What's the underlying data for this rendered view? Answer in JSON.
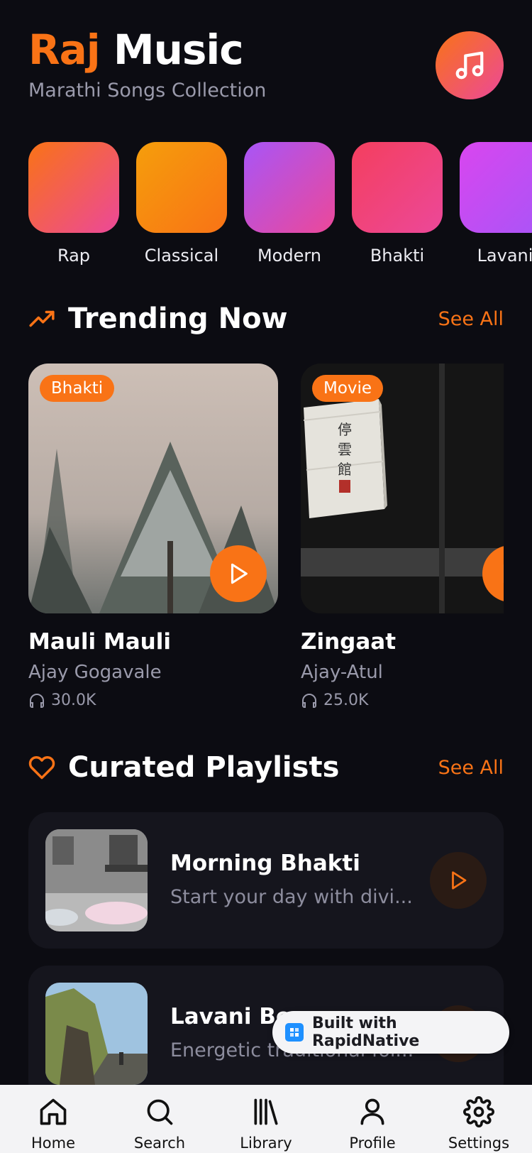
{
  "header": {
    "title_accent": "Raj",
    "title_rest": "Music",
    "subtitle": "Marathi Songs Collection",
    "logo_icon": "music-note-icon"
  },
  "genres": [
    {
      "label": "Rap",
      "gradient": [
        "#f97316",
        "#ec4899"
      ]
    },
    {
      "label": "Classical",
      "gradient": [
        "#f59e0b",
        "#f97316"
      ]
    },
    {
      "label": "Modern",
      "gradient": [
        "#a855f7",
        "#ec4899"
      ]
    },
    {
      "label": "Bhakti",
      "gradient": [
        "#f43f5e",
        "#ec4899"
      ]
    },
    {
      "label": "Lavani",
      "gradient": [
        "#d946ef",
        "#a855f7"
      ]
    }
  ],
  "trending": {
    "title": "Trending Now",
    "see_all": "See All",
    "tracks": [
      {
        "badge": "Bhakti",
        "title": "Mauli Mauli",
        "artist": "Ajay Gogavale",
        "plays": "30.0K"
      },
      {
        "badge": "Movie",
        "title": "Zingaat",
        "artist": "Ajay-Atul",
        "plays": "25.0K"
      }
    ]
  },
  "playlists": {
    "title": "Curated Playlists",
    "see_all": "See All",
    "items": [
      {
        "title": "Morning Bhakti",
        "description": "Start your day with divi..."
      },
      {
        "title": "Lavani Be",
        "description": "Energetic traditional fol..."
      }
    ]
  },
  "built_with": "Built with RapidNative",
  "tabbar": [
    {
      "label": "Home",
      "icon": "home-icon"
    },
    {
      "label": "Search",
      "icon": "search-icon"
    },
    {
      "label": "Library",
      "icon": "library-icon"
    },
    {
      "label": "Profile",
      "icon": "user-icon"
    },
    {
      "label": "Settings",
      "icon": "gear-icon"
    }
  ],
  "colors": {
    "accent": "#f97316",
    "background": "#0c0c12",
    "card": "#15151d"
  }
}
